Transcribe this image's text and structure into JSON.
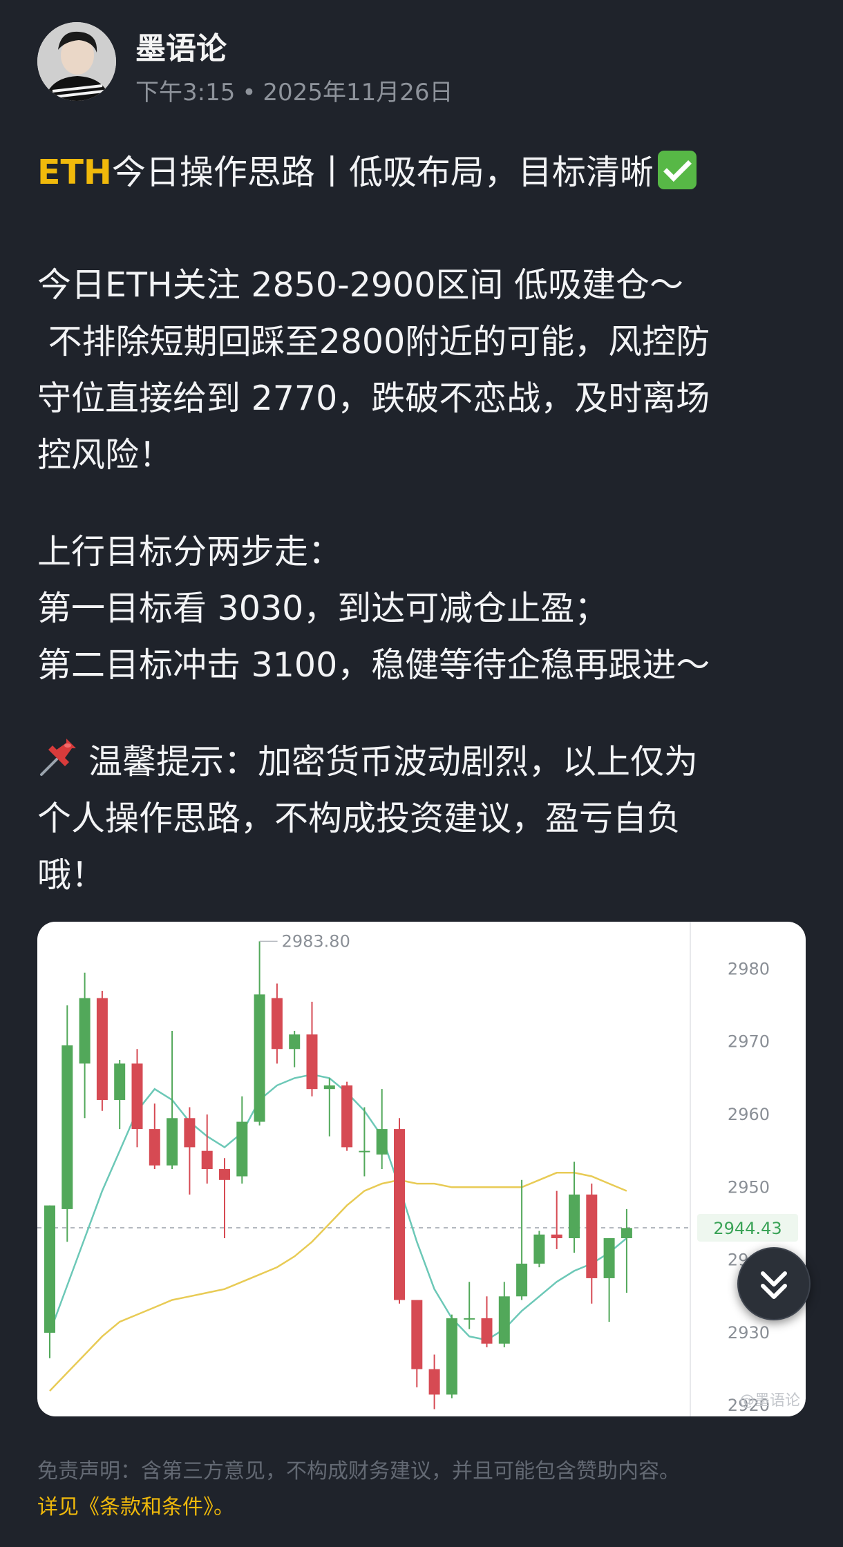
{
  "post": {
    "author": "墨语论",
    "time": "下午3:15",
    "date": "2025年11月26日",
    "title_ticker": "ETH",
    "title_rest": "今日操作思路丨低吸布局，目标清晰",
    "check_icon": "check-mark-icon",
    "para1_line1": "今日ETH关注 2850-2900区间 低吸建仓～",
    "para1_line2": " 不排除短期回踩至2800附近的可能，风控防",
    "para1_line3": "守位直接给到 2770，跌破不恋战，及时离场",
    "para1_line4": "控风险！",
    "para2_line1": "上行目标分两步走：",
    "para2_line2": "第一目标看 3030，到达可减仓止盈；",
    "para2_line3": "第二目标冲击 3100，稳健等待企稳再跟进～",
    "pin_icon": "pushpin-icon",
    "para3_line1": "温馨提示：加密货币波动剧烈，以上仅为",
    "para3_line2": "个人操作思路，不构成投资建议，盈亏自负",
    "para3_line3": "哦！"
  },
  "chart_data": {
    "type": "candlestick",
    "y_ticks": [
      "2980",
      "2970",
      "2960",
      "2950",
      "2940",
      "2930",
      "2920"
    ],
    "ylim": [
      2918.5,
      2986.5
    ],
    "high_label": "2983.80",
    "current_price": "2944.43",
    "watermark": "@墨语论",
    "colors": {
      "up": "#52a85a",
      "down": "#d64a53",
      "ma_short": "#6cc8b7",
      "ma_long": "#e8cb55",
      "price_tag": "#3aa357"
    },
    "candles": [
      {
        "o": 2930.0,
        "h": 2947.5,
        "l": 2926.5,
        "c": 2947.5
      },
      {
        "o": 2947.0,
        "h": 2975.0,
        "l": 2942.5,
        "c": 2969.5
      },
      {
        "o": 2967.0,
        "h": 2979.5,
        "l": 2959.5,
        "c": 2976.0
      },
      {
        "o": 2976.0,
        "h": 2977.0,
        "l": 2960.5,
        "c": 2962.0
      },
      {
        "o": 2962.0,
        "h": 2967.5,
        "l": 2958.0,
        "c": 2967.0
      },
      {
        "o": 2967.0,
        "h": 2969.0,
        "l": 2955.5,
        "c": 2958.0
      },
      {
        "o": 2958.0,
        "h": 2961.5,
        "l": 2952.5,
        "c": 2953.0
      },
      {
        "o": 2953.0,
        "h": 2971.5,
        "l": 2952.5,
        "c": 2959.5
      },
      {
        "o": 2959.5,
        "h": 2961.0,
        "l": 2949.0,
        "c": 2955.5
      },
      {
        "o": 2955.0,
        "h": 2960.0,
        "l": 2950.5,
        "c": 2952.5
      },
      {
        "o": 2952.5,
        "h": 2954.0,
        "l": 2943.0,
        "c": 2951.0
      },
      {
        "o": 2951.5,
        "h": 2962.5,
        "l": 2950.5,
        "c": 2959.0
      },
      {
        "o": 2959.0,
        "h": 2983.8,
        "l": 2958.5,
        "c": 2976.5
      },
      {
        "o": 2976.0,
        "h": 2978.0,
        "l": 2967.0,
        "c": 2969.0
      },
      {
        "o": 2969.0,
        "h": 2971.5,
        "l": 2966.5,
        "c": 2971.0
      },
      {
        "o": 2971.0,
        "h": 2975.5,
        "l": 2962.5,
        "c": 2963.5
      },
      {
        "o": 2963.5,
        "h": 2965.0,
        "l": 2957.0,
        "c": 2964.0
      },
      {
        "o": 2964.0,
        "h": 2964.5,
        "l": 2955.0,
        "c": 2955.5
      },
      {
        "o": 2955.0,
        "h": 2961.0,
        "l": 2951.5,
        "c": 2955.0
      },
      {
        "o": 2954.5,
        "h": 2963.5,
        "l": 2952.5,
        "c": 2958.0
      },
      {
        "o": 2958.0,
        "h": 2959.5,
        "l": 2934.0,
        "c": 2934.5
      },
      {
        "o": 2934.5,
        "h": 2934.5,
        "l": 2922.5,
        "c": 2925.0
      },
      {
        "o": 2925.0,
        "h": 2927.0,
        "l": 2919.5,
        "c": 2921.5
      },
      {
        "o": 2921.5,
        "h": 2932.5,
        "l": 2921.0,
        "c": 2932.0
      },
      {
        "o": 2932.0,
        "h": 2937.0,
        "l": 2930.5,
        "c": 2932.0
      },
      {
        "o": 2932.0,
        "h": 2935.0,
        "l": 2928.0,
        "c": 2928.5
      },
      {
        "o": 2928.5,
        "h": 2937.0,
        "l": 2928.0,
        "c": 2935.0
      },
      {
        "o": 2935.0,
        "h": 2951.0,
        "l": 2934.5,
        "c": 2939.5
      },
      {
        "o": 2939.5,
        "h": 2944.0,
        "l": 2939.0,
        "c": 2943.5
      },
      {
        "o": 2943.5,
        "h": 2949.5,
        "l": 2941.5,
        "c": 2943.0
      },
      {
        "o": 2943.0,
        "h": 2953.5,
        "l": 2941.0,
        "c": 2949.0
      },
      {
        "o": 2949.0,
        "h": 2950.5,
        "l": 2934.0,
        "c": 2937.5
      },
      {
        "o": 2937.5,
        "h": 2943.0,
        "l": 2931.5,
        "c": 2943.0
      },
      {
        "o": 2943.0,
        "h": 2947.0,
        "l": 2935.5,
        "c": 2944.4
      }
    ],
    "ma_short": [
      2930.0,
      2936.5,
      2943.0,
      2949.5,
      2955.0,
      2960.5,
      2963.5,
      2962.0,
      2959.0,
      2957.0,
      2955.5,
      2957.5,
      2962.0,
      2964.0,
      2965.0,
      2965.5,
      2965.0,
      2963.0,
      2960.5,
      2957.0,
      2950.0,
      2942.5,
      2936.0,
      2932.0,
      2929.5,
      2929.0,
      2930.5,
      2933.0,
      2935.0,
      2937.0,
      2938.5,
      2939.5,
      2941.0,
      2943.0
    ],
    "ma_long": [
      2922.0,
      2924.5,
      2927.0,
      2929.5,
      2931.5,
      2932.5,
      2933.5,
      2934.5,
      2935.0,
      2935.5,
      2936.0,
      2937.0,
      2938.0,
      2939.0,
      2940.5,
      2942.5,
      2945.0,
      2947.5,
      2949.5,
      2950.5,
      2951.0,
      2950.5,
      2950.5,
      2950.0,
      2950.0,
      2950.0,
      2950.0,
      2950.0,
      2951.0,
      2952.0,
      2952.0,
      2951.5,
      2950.5,
      2949.5
    ]
  },
  "fab": {
    "icon": "double-chevron-down-icon"
  },
  "disclaimer": {
    "text": "免责声明：含第三方意见，不构成财务建议，并且可能包含赞助内容。",
    "link": "详见《条款和条件》。"
  }
}
